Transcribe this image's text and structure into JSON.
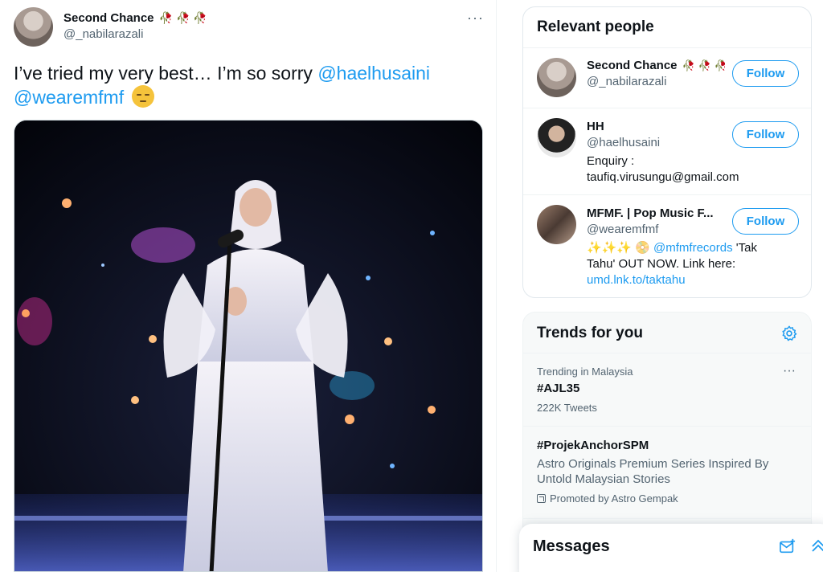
{
  "tweet": {
    "author_name": "Second Chance",
    "author_emojis": "🥀🥀🥀",
    "author_handle": "@_nabilarazali",
    "more_label": "···",
    "text_prefix": "I’ve tried my very best… I’m so sorry ",
    "mention_1": "@haelhusaini",
    "mention_2": "@wearemfmf",
    "media_alt": ""
  },
  "sidebar": {
    "relevant_title": "Relevant people",
    "people": [
      {
        "name": "Second Chance",
        "emojis": "🥀🥀🥀",
        "handle": "@_nabilarazali",
        "bio_lines": [],
        "follow_label": "Follow"
      },
      {
        "name": "HH",
        "emojis": "",
        "handle": "@haelhusaini",
        "bio_lines": [
          "Enquiry :",
          "taufiq.virusungu@gmail.com"
        ],
        "follow_label": "Follow"
      },
      {
        "name": "MFMF. | Pop Music F...",
        "emojis": "",
        "handle": "@wearemfmf",
        "bio_lines": [
          "✨✨✨ 📀 ",
          "Tahu' OUT NOW. Link here:"
        ],
        "bio_mention": "@mfmfrecords",
        "bio_tail": " 'Tak",
        "bio_link": "umd.lnk.to/taktahu",
        "follow_label": "Follow"
      }
    ],
    "trends_title": "Trends for you",
    "trends": [
      {
        "meta": "Trending in Malaysia",
        "name": "#AJL35",
        "count": "222K Tweets"
      },
      {
        "meta": "",
        "name": "#ProjekAnchorSPM",
        "desc": "Astro Originals Premium Series Inspired By Untold Malaysian Stories",
        "promo": "Promoted by Astro Gempak"
      }
    ],
    "trend_more": "···"
  },
  "messages": {
    "title": "Messages"
  },
  "colors": {
    "accent": "#1d9bf0",
    "text_primary": "#0f1419",
    "text_secondary": "#536471"
  }
}
